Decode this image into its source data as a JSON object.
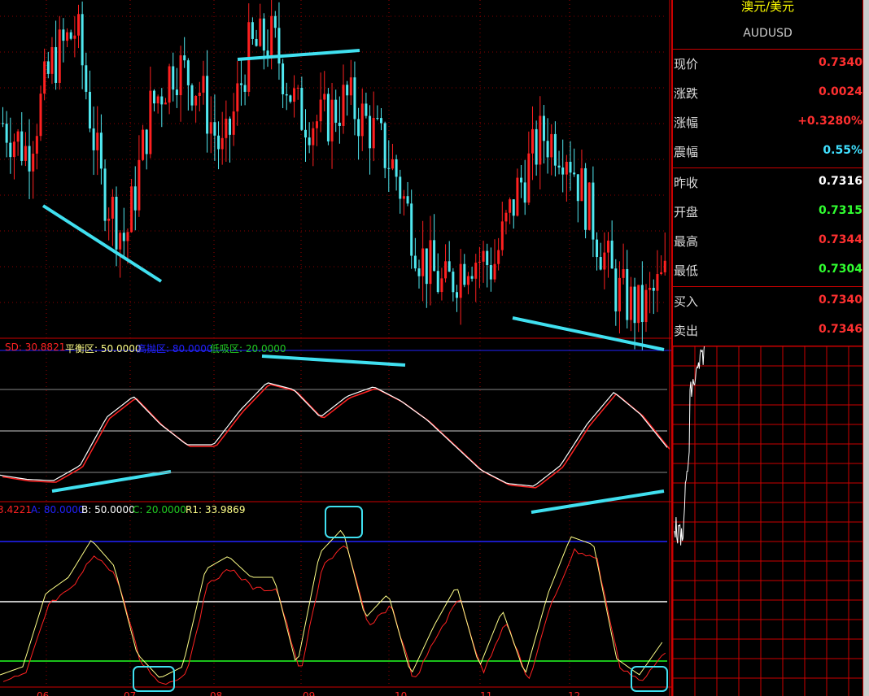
{
  "panel": {
    "title": "澳元/美元",
    "symbol": "AUDUSD",
    "rows": [
      {
        "label": "现价",
        "value": "0.7340",
        "color": "#ff3030"
      },
      {
        "label": "涨跌",
        "value": "0.0024",
        "color": "#ff3030"
      },
      {
        "label": "涨幅",
        "value": "+0.3280%",
        "color": "#ff3030"
      },
      {
        "label": "震幅",
        "value": "0.55%",
        "color": "#40e0ff"
      },
      {
        "label": "昨收",
        "value": "0.7316",
        "color": "#ffffff"
      },
      {
        "label": "开盘",
        "value": "0.7315",
        "color": "#30ff30"
      },
      {
        "label": "最高",
        "value": "0.7344",
        "color": "#ff3030"
      },
      {
        "label": "最低",
        "value": "0.7304",
        "color": "#30ff30"
      },
      {
        "label": "买入",
        "value": "0.7340",
        "color": "#ff3030"
      },
      {
        "label": "卖出",
        "value": "0.7346",
        "color": "#ff3030"
      }
    ]
  },
  "indicator1": {
    "sd": "SD: 30.8821",
    "mid": "平衡区: 50.0000",
    "high": "高抛区: 80.0000",
    "low": "低吸区: 20.0000"
  },
  "indicator2": {
    "first": "3.4221",
    "a": "A: 80.0000",
    "b": "B: 50.0000",
    "c": "C: 20.0000",
    "r1": "R1: 33.9869"
  },
  "chart_data": [
    {
      "type": "candlestick",
      "title": "AUDUSD",
      "x_ticks": [
        "06",
        "07",
        "08",
        "09",
        "10",
        "11",
        "12"
      ],
      "close_path": [
        0.737,
        0.7358,
        0.7395,
        0.741,
        0.7345,
        0.732,
        0.7375,
        0.7395,
        0.7385,
        0.7355,
        0.74,
        0.7405,
        0.7375,
        0.737,
        0.738,
        0.7368,
        0.735,
        0.7315,
        0.73,
        0.7315,
        0.731,
        0.7342,
        0.7365,
        0.736,
        0.733,
        0.73,
        0.729,
        0.7305
      ],
      "ylim": [
        0.728,
        0.742
      ]
    },
    {
      "type": "line",
      "title": "oscillator 1",
      "series": [
        {
          "name": "white",
          "values": [
            18,
            15,
            14,
            25,
            60,
            75,
            55,
            40,
            40,
            65,
            85,
            80,
            60,
            75,
            82,
            72,
            58,
            40,
            22,
            12,
            10,
            25,
            55,
            78,
            62,
            38
          ]
        }
      ],
      "levels": [
        80,
        50,
        20
      ],
      "ylim": [
        0,
        100
      ]
    },
    {
      "type": "line",
      "title": "oscillator 2",
      "series": [
        {
          "name": "yellow",
          "values": [
            5,
            10,
            55,
            65,
            88,
            72,
            18,
            3,
            10,
            70,
            78,
            65,
            65,
            10,
            80,
            95,
            40,
            55,
            5,
            35,
            60,
            10,
            45,
            5,
            55,
            90,
            85,
            15,
            5,
            25
          ]
        }
      ],
      "levels": [
        80,
        50,
        20
      ],
      "ylim": [
        0,
        100
      ]
    }
  ]
}
